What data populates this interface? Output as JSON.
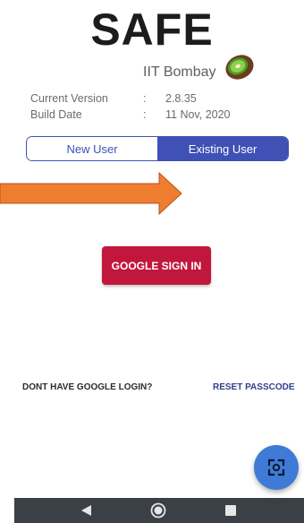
{
  "header": {
    "app_title": "SAFE",
    "org": "IIT Bombay"
  },
  "info": {
    "version_label": "Current Version",
    "version_value": "2.8.35",
    "build_label": "Build Date",
    "build_value": "11 Nov, 2020",
    "separator": ":"
  },
  "tabs": {
    "new_user": "New User",
    "existing_user": "Existing User",
    "selected": "Existing User"
  },
  "actions": {
    "google_sign_in": "GOOGLE SIGN IN",
    "no_google_login": "DONT HAVE GOOGLE LOGIN?",
    "reset_passcode": "RESET PASSCODE"
  },
  "fab": {
    "icon": "scan-icon"
  },
  "navbar": {
    "icons": [
      "back-icon",
      "home-icon",
      "recents-icon"
    ]
  },
  "colors": {
    "primary": "#3f51b5",
    "google_button": "#c2173c",
    "fab": "#3f7bd6",
    "arrow": "#ef7d2f",
    "navbar": "#3a4046"
  }
}
